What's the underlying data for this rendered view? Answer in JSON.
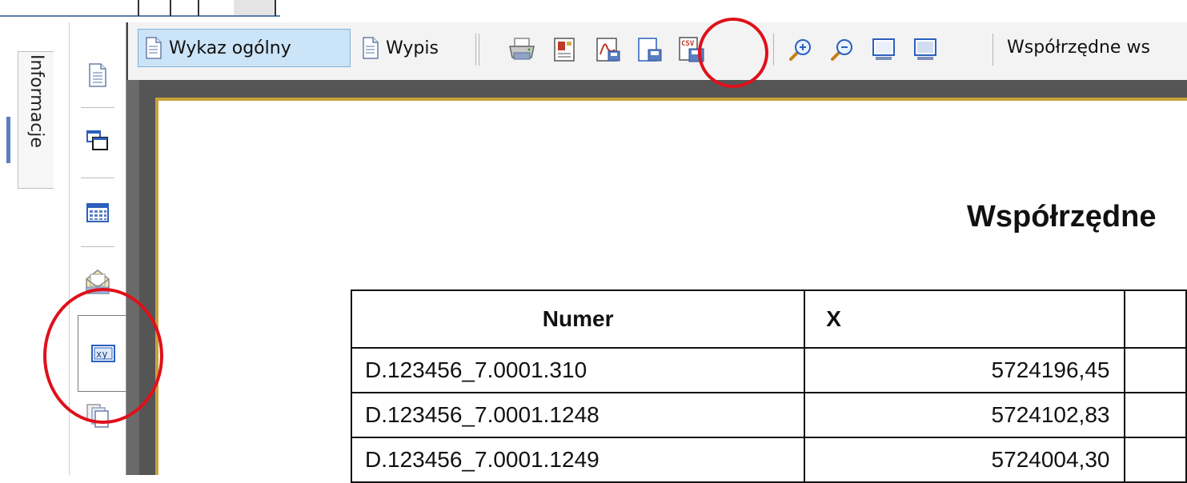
{
  "sidebar_tab": {
    "label": "Informacje"
  },
  "toolbar": {
    "tabs": [
      {
        "label": "Wykaz ogólny",
        "icon": "document-icon",
        "active": true
      },
      {
        "label": "Wypis",
        "icon": "document-icon",
        "active": false
      }
    ],
    "buttons": [
      {
        "name": "print-button",
        "icon": "printer-icon"
      },
      {
        "name": "export-button",
        "icon": "export-document-icon"
      },
      {
        "name": "save-pdf-button",
        "icon": "pdf-save-icon"
      },
      {
        "name": "save-file-button",
        "icon": "save-file-icon"
      },
      {
        "name": "save-csv-button",
        "icon": "csv-save-icon"
      },
      {
        "name": "zoom-in-button",
        "icon": "zoom-in-icon"
      },
      {
        "name": "zoom-out-button",
        "icon": "zoom-out-icon"
      },
      {
        "name": "view-screen-button",
        "icon": "monitor-icon"
      },
      {
        "name": "view-screen-alt-button",
        "icon": "monitor-icon"
      }
    ],
    "view_label": "Współrzędne ws"
  },
  "side_icons": [
    {
      "name": "document-icon"
    },
    {
      "name": "windows-icon"
    },
    {
      "name": "table-grid-icon"
    },
    {
      "name": "envelope-icon"
    },
    {
      "name": "xy-icon",
      "active": true
    },
    {
      "name": "copy-pages-icon"
    }
  ],
  "document": {
    "title": "Współrzędne",
    "columns": [
      "Numer",
      "X"
    ],
    "rows": [
      {
        "numer": "D.123456_7.0001.310",
        "x": "5724196,45"
      },
      {
        "numer": "D.123456_7.0001.1248",
        "x": "5724102,83"
      },
      {
        "numer": "D.123456_7.0001.1249",
        "x": "5724004,30"
      }
    ]
  },
  "colors": {
    "annotation": "#e0101a",
    "active_tab": "#cce4f7",
    "page_border": "#c9a33a",
    "viewer_background": "#555555"
  }
}
